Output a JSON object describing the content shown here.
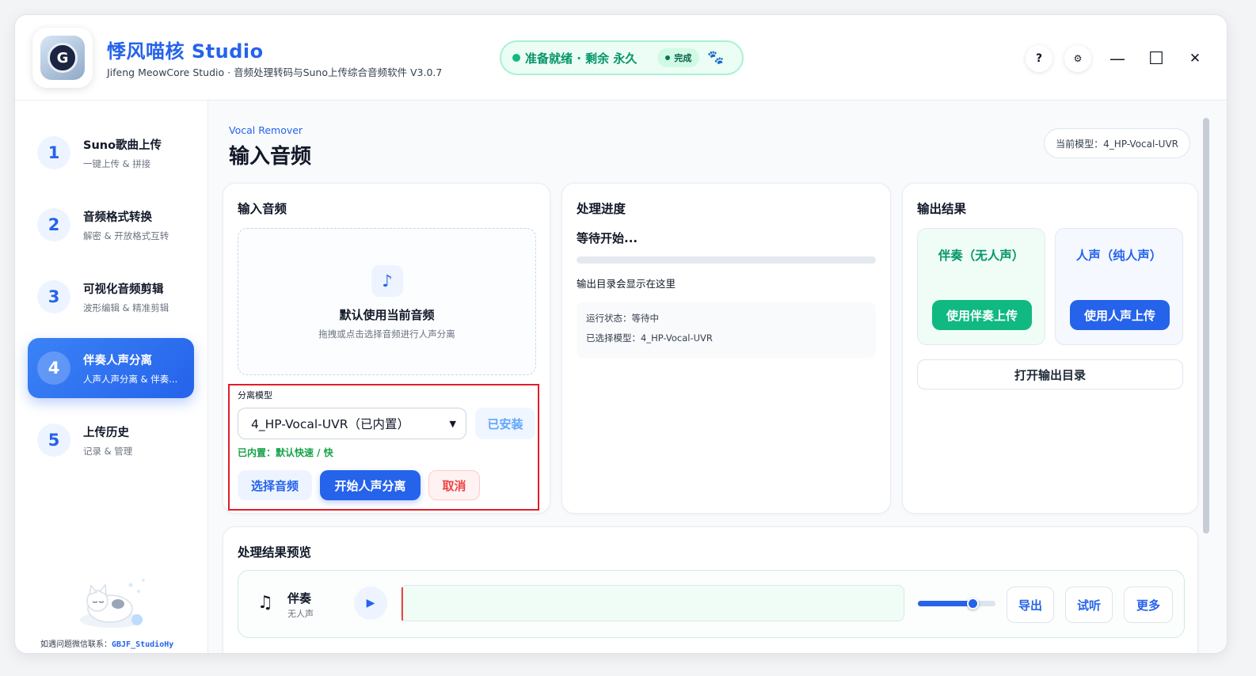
{
  "app": {
    "title": "悸风喵核 Studio",
    "subtitle": "Jifeng MeowCore Studio · 音频处理转码与Suno上传综合音频软件 V3.0.7",
    "logo_letter": "G"
  },
  "status": {
    "text": "准备就绪 · 剩余 永久",
    "badge": "完成",
    "paw_icon": "🐾"
  },
  "titlebar_buttons": {
    "help": "?",
    "settings": "⚙"
  },
  "window_controls": {
    "minimize": "—",
    "maximize": "☐",
    "close": "✕"
  },
  "sidebar": {
    "items": [
      {
        "num": "1",
        "title": "Suno歌曲上传",
        "desc": "一键上传 & 拼接",
        "active": false
      },
      {
        "num": "2",
        "title": "音频格式转换",
        "desc": "解密 & 开放格式互转",
        "active": false
      },
      {
        "num": "3",
        "title": "可视化音频剪辑",
        "desc": "波形编辑 & 精准剪辑",
        "active": false
      },
      {
        "num": "4",
        "title": "伴奏人声分离",
        "desc": "人声人声分离 & 伴奏...",
        "active": true
      },
      {
        "num": "5",
        "title": "上传历史",
        "desc": "记录 & 管理",
        "active": false
      }
    ],
    "contact_label": "如遇问题微信联系：",
    "contact_id": "GBJF_StudioHy"
  },
  "page": {
    "eyebrow": "Vocal Remover",
    "title": "输入音频",
    "current_model": "当前模型：4_HP-Vocal-UVR"
  },
  "input_card": {
    "title": "输入音频",
    "drop_icon": "♪",
    "drop_title": "默认使用当前音频",
    "drop_subtitle": "拖拽或点击选择音频进行人声分离",
    "model_label": "分离模型",
    "model_value": "4_HP-Vocal-UVR（已内置）",
    "installed": "已安装",
    "builtin_note": "已内置：默认快速 / 快",
    "select_audio": "选择音频",
    "start": "开始人声分离",
    "cancel": "取消"
  },
  "progress_card": {
    "title": "处理进度",
    "status": "等待开始...",
    "progress": 0,
    "outdir_hint": "输出目录会显示在这里",
    "log_status": "运行状态：等待中",
    "log_model": "已选择模型：4_HP-Vocal-UVR"
  },
  "output_card": {
    "title": "输出结果",
    "accomp_title": "伴奏（无人声）",
    "accomp_button": "使用伴奏上传",
    "vocal_title": "人声（纯人声）",
    "vocal_button": "使用人声上传",
    "open_dir": "打开输出目录"
  },
  "preview": {
    "title": "处理结果预览",
    "track_icon": "♫",
    "track_name": "伴奏",
    "track_sub": "无人声",
    "play_icon": "▶",
    "volume": 0.7,
    "export": "导出",
    "listen": "试听",
    "more": "更多"
  },
  "colors": {
    "primary": "#2563eb",
    "success": "#10b981",
    "danger": "#ef4444",
    "highlight_box": "#e11d2a"
  }
}
